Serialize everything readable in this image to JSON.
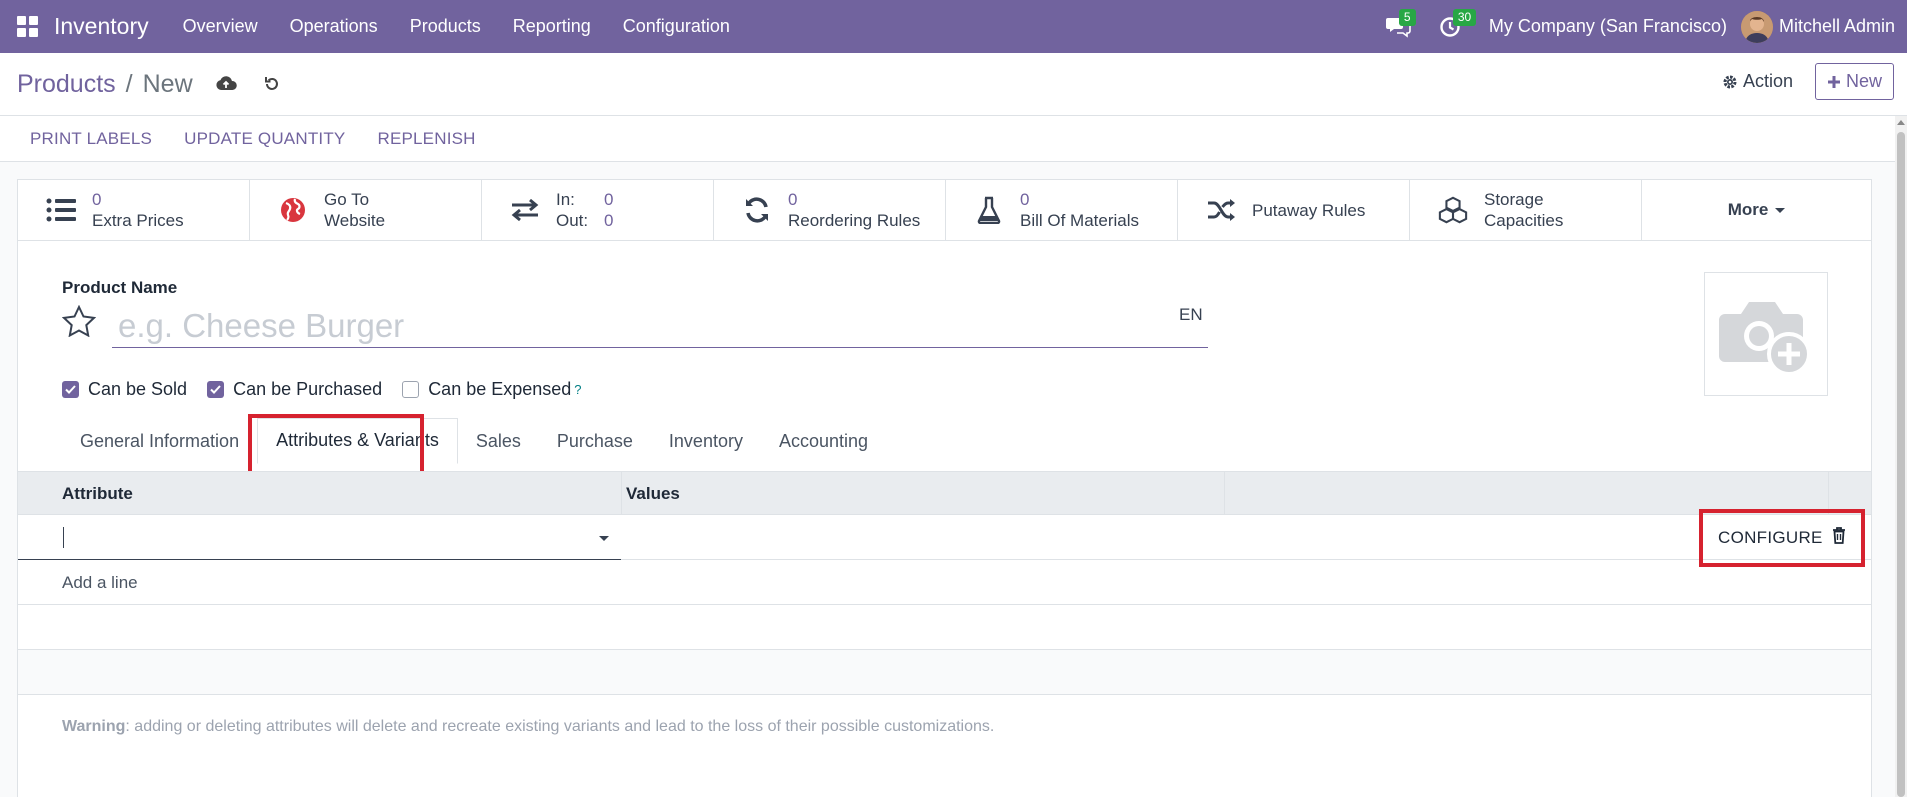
{
  "navbar": {
    "app_name": "Inventory",
    "menus": [
      "Overview",
      "Operations",
      "Products",
      "Reporting",
      "Configuration"
    ],
    "messages_count": "5",
    "activities_count": "30",
    "company": "My Company (San Francisco)",
    "user": "Mitchell Admin"
  },
  "breadcrumb": {
    "parent": "Products",
    "separator": "/",
    "current": "New"
  },
  "control_panel": {
    "action_label": "Action",
    "new_label": "New"
  },
  "statusbar": {
    "buttons": [
      "PRINT LABELS",
      "UPDATE QUANTITY",
      "REPLENISH"
    ]
  },
  "smart_buttons": {
    "extra_prices": {
      "value": "0",
      "label": "Extra Prices"
    },
    "website": {
      "line1": "Go To",
      "line2": "Website"
    },
    "in_out": {
      "in_label": "In:",
      "in_value": "0",
      "out_label": "Out:",
      "out_value": "0"
    },
    "reordering": {
      "value": "0",
      "label": "Reordering Rules"
    },
    "bom": {
      "value": "0",
      "label": "Bill Of Materials"
    },
    "putaway": {
      "label": "Putaway Rules"
    },
    "storage": {
      "line1": "Storage",
      "line2": "Capacities"
    },
    "more": {
      "label": "More"
    }
  },
  "form": {
    "product_name_label": "Product Name",
    "product_name_placeholder": "e.g. Cheese Burger",
    "product_name_value": "",
    "lang": "EN",
    "checkboxes": [
      {
        "label": "Can be Sold",
        "checked": true
      },
      {
        "label": "Can be Purchased",
        "checked": true
      },
      {
        "label": "Can be Expensed",
        "checked": false,
        "help": "?"
      }
    ],
    "tabs": [
      "General Information",
      "Attributes & Variants",
      "Sales",
      "Purchase",
      "Inventory",
      "Accounting"
    ],
    "active_tab": "Attributes & Variants"
  },
  "attributes_table": {
    "headers": {
      "attribute": "Attribute",
      "values": "Values"
    },
    "row": {
      "attribute": "",
      "values": "",
      "configure_label": "CONFIGURE"
    },
    "add_line": "Add a line",
    "warning_bold": "Warning",
    "warning_text": ": adding or deleting attributes will delete and recreate existing variants and lead to the loss of their possible customizations."
  },
  "colors": {
    "brand": "#71639e",
    "highlight": "#d6222f",
    "badge": "#28a745"
  }
}
